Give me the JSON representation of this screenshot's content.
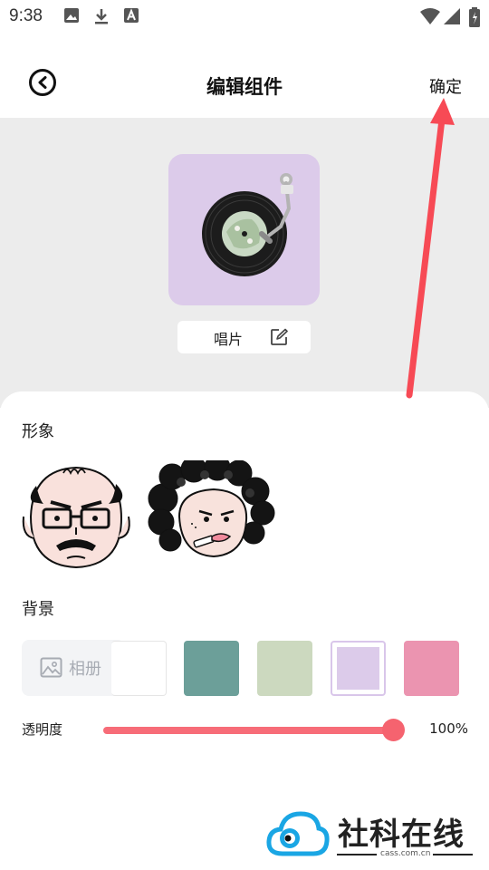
{
  "status_bar": {
    "time": "9:38",
    "left_icons": [
      "image-icon",
      "download-icon",
      "text-a-icon"
    ],
    "right_icons": [
      "wifi-icon",
      "signal-icon",
      "battery-icon"
    ]
  },
  "header": {
    "title": "编辑组件",
    "confirm_label": "确定",
    "back_icon": "chevron-left-icon"
  },
  "preview": {
    "widget_name": "唱片",
    "widget_color": "#dccbea",
    "edit_icon": "edit-icon"
  },
  "avatar_section": {
    "label": "形象",
    "avatars": [
      "bald-man-avatar",
      "curly-hair-lady-avatar"
    ]
  },
  "background_section": {
    "label": "背景",
    "album_label": "相册",
    "swatches": [
      {
        "color": "#ffffff",
        "selected": false
      },
      {
        "color": "#6c9f99",
        "selected": false
      },
      {
        "color": "#ccd9bf",
        "selected": false
      },
      {
        "color": "#dccbea",
        "selected": true
      },
      {
        "color": "#eb94b0",
        "selected": false
      }
    ]
  },
  "opacity": {
    "label": "透明度",
    "value_text": "100%",
    "value": 1.0,
    "accent": "#f5636f"
  },
  "watermark": {
    "brand": "社科在线",
    "domain": "cass.com.cn"
  }
}
